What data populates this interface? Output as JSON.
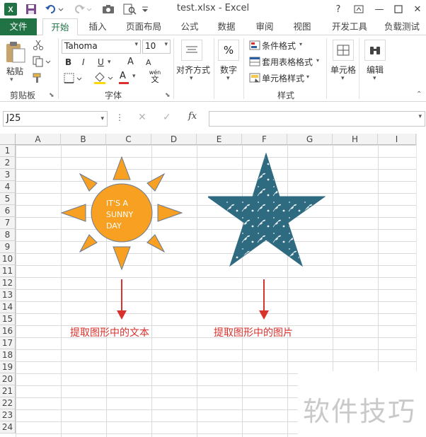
{
  "titlebar": {
    "title": "test.xlsx - Excel",
    "help": "?",
    "minimize": "—",
    "close": "✕"
  },
  "tabs": [
    "文件",
    "开始",
    "插入",
    "页面布局",
    "公式",
    "数据",
    "审阅",
    "视图",
    "开发工具",
    "负载测试"
  ],
  "ribbon": {
    "clipboard": {
      "paste": "粘贴",
      "label": "剪贴板"
    },
    "font": {
      "name": "Tahoma",
      "size": "10",
      "bold": "B",
      "italic": "I",
      "underline": "U",
      "grow": "A",
      "shrink": "A",
      "label": "字体",
      "font_color": "A",
      "phonetic_top": "wén",
      "phonetic_bottom": "文"
    },
    "align": {
      "label": "对齐方式"
    },
    "number": {
      "symbol": "%",
      "label": "数字"
    },
    "styles": {
      "cond": "条件格式",
      "table": "套用表格格式",
      "cell": "单元格样式",
      "label": "样式"
    },
    "cells": {
      "label": "单元格"
    },
    "edit": {
      "label": "编辑"
    }
  },
  "formula_bar": {
    "name_box": "J25",
    "fx": "fx",
    "content": ""
  },
  "columns": [
    "A",
    "B",
    "C",
    "D",
    "E",
    "F",
    "G",
    "H",
    "I"
  ],
  "rows": [
    "1",
    "2",
    "3",
    "4",
    "5",
    "6",
    "7",
    "8",
    "9",
    "10",
    "11",
    "12",
    "13",
    "14",
    "15",
    "16",
    "17",
    "18",
    "19",
    "20",
    "21",
    "22",
    "23",
    "24"
  ],
  "sun": {
    "line1": "IT'S A",
    "line2": "SUNNY",
    "line3": "DAY",
    "color": "#f7a022"
  },
  "star": {
    "color": "#2f6b80"
  },
  "captions": {
    "left": "提取图形中的文本",
    "right": "提取图形中的图片"
  },
  "watermark": "软件技巧",
  "colors": {
    "accent": "#217346",
    "arrow": "#d9312c"
  }
}
